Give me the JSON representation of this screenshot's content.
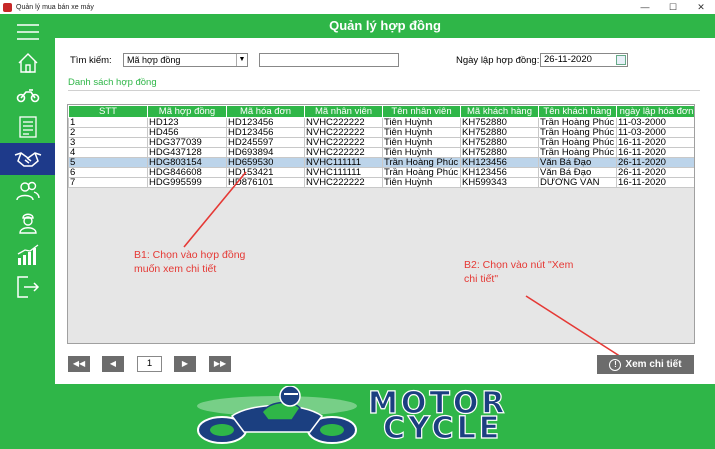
{
  "window": {
    "title": "Quản lý mua bán xe máy",
    "minimize": "—",
    "maximize": "☐",
    "close": "✕"
  },
  "header": {
    "title": "Quản lý hợp đồng"
  },
  "sidebar": {
    "items": [
      {
        "icon": "hamburger-menu-icon"
      },
      {
        "icon": "home-icon"
      },
      {
        "icon": "motorbike-icon"
      },
      {
        "icon": "document-icon"
      },
      {
        "icon": "handshake-icon",
        "active": true
      },
      {
        "icon": "users-icon"
      },
      {
        "icon": "employee-icon"
      },
      {
        "icon": "chart-icon"
      },
      {
        "icon": "logout-icon"
      }
    ]
  },
  "search": {
    "label": "Tìm kiếm:",
    "field_selected": "Mã hợp đồng",
    "query": "",
    "date_label": "Ngày lập hợp đồng:",
    "date_value": "26-11-2020"
  },
  "group_title": "Danh sách hợp đồng",
  "table": {
    "columns": [
      "STT",
      "Mã hợp đồng",
      "Mã hóa đơn",
      "Mã nhân viên",
      "Tên nhân viên",
      "Mã khách hàng",
      "Tên khách hàng",
      "ngày lập hóa đơn"
    ],
    "rows": [
      [
        "1",
        "HD123",
        "HD123456",
        "NVHC222222",
        "Tiên Huỳnh",
        "KH752880",
        "Trần Hoàng Phúc",
        "11-03-2000"
      ],
      [
        "2",
        "HD456",
        "HD123456",
        "NVHC222222",
        "Tiên Huỳnh",
        "KH752880",
        "Trần Hoàng Phúc",
        "11-03-2000"
      ],
      [
        "3",
        "HDG377039",
        "HD245597",
        "NVHC222222",
        "Tiên Huỳnh",
        "KH752880",
        "Trần Hoàng Phúc",
        "16-11-2020"
      ],
      [
        "4",
        "HDG437128",
        "HD693894",
        "NVHC222222",
        "Tiên Huỳnh",
        "KH752880",
        "Trần Hoàng Phúc",
        "16-11-2020"
      ],
      [
        "5",
        "HDG803154",
        "HD659530",
        "NVHC111111",
        "Trần Hoàng Phúc",
        "KH123456",
        "Văn Bá Đạo",
        "26-11-2020"
      ],
      [
        "6",
        "HDG846608",
        "HD153421",
        "NVHC111111",
        "Trần Hoàng Phúc",
        "KH123456",
        "Văn Bá Đạo",
        "26-11-2020"
      ],
      [
        "7",
        "HDG995599",
        "HD876101",
        "NVHC222222",
        "Tiên Huỳnh",
        "KH599343",
        "DƯƠNG VĂN",
        "16-11-2020"
      ]
    ],
    "selected_row": 4
  },
  "annotations": {
    "step1_line1": "B1: Chọn vào hợp đồng",
    "step1_line2": "muốn xem chi tiết",
    "step2_line1": "B2: Chọn vào nút \"Xem",
    "step2_line2": "chi tiết\"",
    "color": "#e53935"
  },
  "pager": {
    "first": "◀◀",
    "prev": "◀",
    "page": "1",
    "next": "▶",
    "last": "▶▶"
  },
  "detail_button": {
    "label": "Xem chi tiết",
    "icon": "info-icon"
  },
  "banner": {
    "line1": "MOTOR",
    "line2": "CYCLE"
  },
  "colors": {
    "accent": "#2fb648",
    "active_nav": "#1e3a8a",
    "selected_row": "#bcd4ea",
    "button": "#6c6c6c"
  }
}
